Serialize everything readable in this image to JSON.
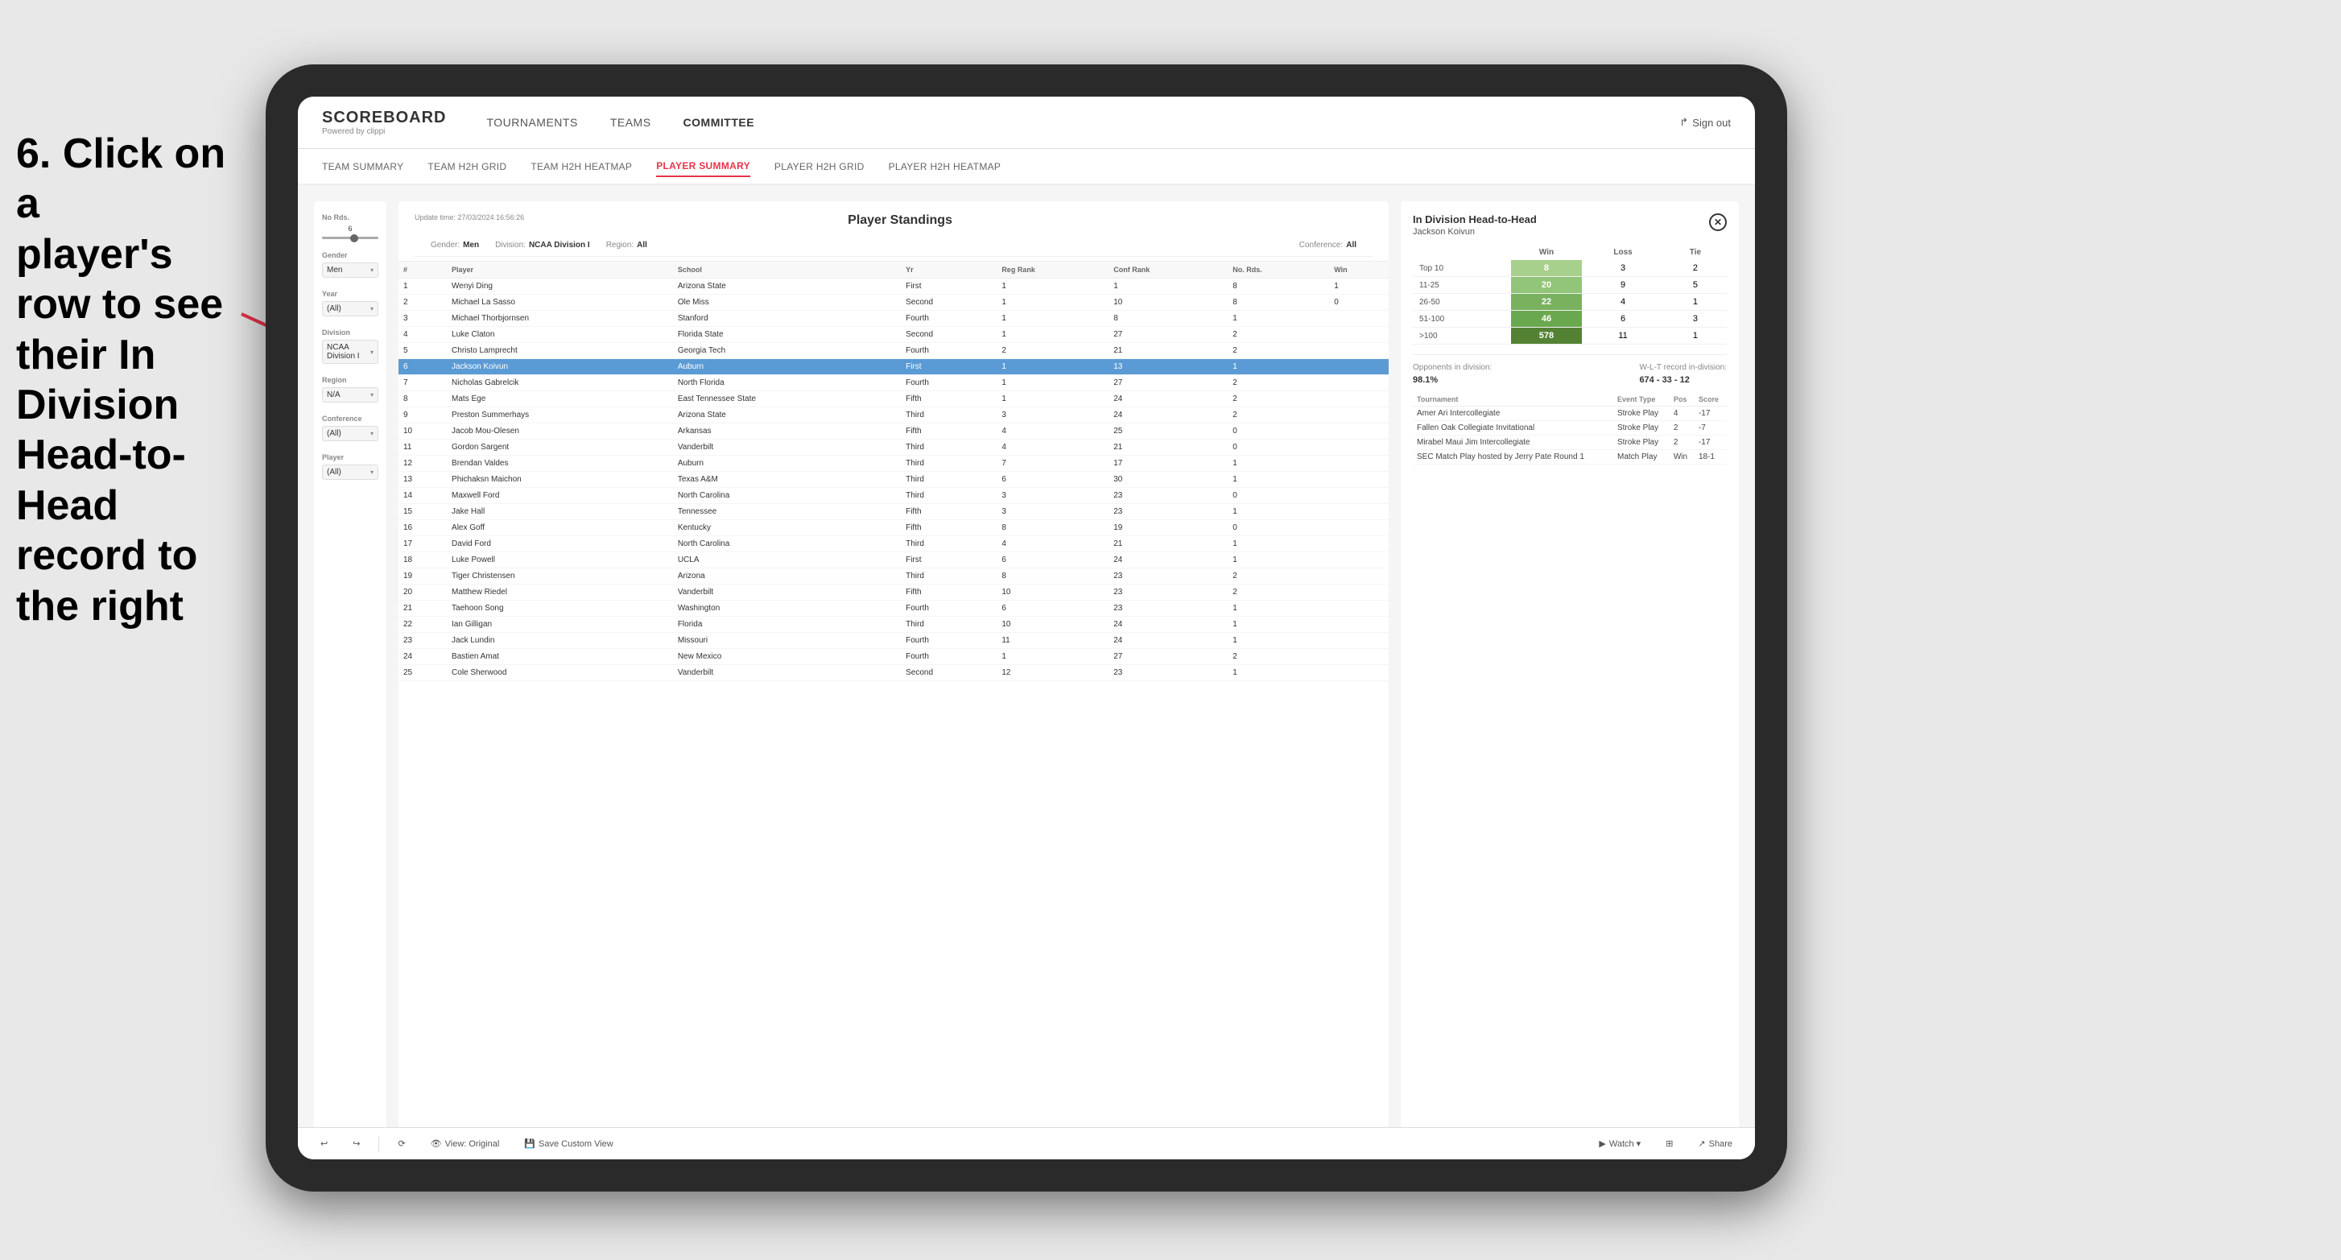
{
  "instruction": {
    "line1": "6. Click on a",
    "line2": "player's row to see",
    "line3": "their In Division",
    "line4": "Head-to-Head",
    "line5": "record to the right"
  },
  "app": {
    "logo": "SCOREBOARD",
    "logo_sub": "Powered by clippi",
    "sign_out": "Sign out"
  },
  "nav": {
    "items": [
      {
        "label": "TOURNAMENTS",
        "active": false
      },
      {
        "label": "TEAMS",
        "active": false
      },
      {
        "label": "COMMITTEE",
        "active": true
      }
    ]
  },
  "sub_nav": {
    "items": [
      {
        "label": "TEAM SUMMARY",
        "active": false
      },
      {
        "label": "TEAM H2H GRID",
        "active": false
      },
      {
        "label": "TEAM H2H HEATMAP",
        "active": false
      },
      {
        "label": "PLAYER SUMMARY",
        "active": true
      },
      {
        "label": "PLAYER H2H GRID",
        "active": false
      },
      {
        "label": "PLAYER H2H HEATMAP",
        "active": false
      }
    ]
  },
  "sidebar": {
    "no_rds_label": "No Rds.",
    "no_rds_value": "6",
    "gender_label": "Gender",
    "gender_value": "Men",
    "year_label": "Year",
    "year_value": "(All)",
    "division_label": "Division",
    "division_value": "NCAA Division I",
    "region_label": "Region",
    "region_value": "N/A",
    "conference_label": "Conference",
    "conference_value": "(All)",
    "player_label": "Player",
    "player_value": "(All)"
  },
  "panel": {
    "title": "Player Standings",
    "update_time": "Update time:",
    "update_date": "27/03/2024 16:56:26",
    "gender_label": "Gender:",
    "gender_value": "Men",
    "division_label": "Division:",
    "division_value": "NCAA Division I",
    "region_label": "Region:",
    "region_value": "All",
    "conference_label": "Conference:",
    "conference_value": "All",
    "columns": [
      "#",
      "Player",
      "School",
      "Yr",
      "Reg Rank",
      "Conf Rank",
      "No. Rds.",
      "Win"
    ],
    "rows": [
      {
        "num": "1",
        "player": "Wenyi Ding",
        "school": "Arizona State",
        "yr": "First",
        "reg": "1",
        "conf": "1",
        "rds": "8",
        "win": "1"
      },
      {
        "num": "2",
        "player": "Michael La Sasso",
        "school": "Ole Miss",
        "yr": "Second",
        "reg": "1",
        "conf": "10",
        "rds": "8",
        "win": "0"
      },
      {
        "num": "3",
        "player": "Michael Thorbjornsen",
        "school": "Stanford",
        "yr": "Fourth",
        "reg": "1",
        "conf": "8",
        "rds": "1"
      },
      {
        "num": "4",
        "player": "Luke Claton",
        "school": "Florida State",
        "yr": "Second",
        "reg": "1",
        "conf": "27",
        "rds": "2"
      },
      {
        "num": "5",
        "player": "Christo Lamprecht",
        "school": "Georgia Tech",
        "yr": "Fourth",
        "reg": "2",
        "conf": "21",
        "rds": "2"
      },
      {
        "num": "6",
        "player": "Jackson Koivun",
        "school": "Auburn",
        "yr": "First",
        "reg": "1",
        "conf": "13",
        "rds": "1",
        "highlighted": true
      },
      {
        "num": "7",
        "player": "Nicholas Gabrelcik",
        "school": "North Florida",
        "yr": "Fourth",
        "reg": "1",
        "conf": "27",
        "rds": "2"
      },
      {
        "num": "8",
        "player": "Mats Ege",
        "school": "East Tennessee State",
        "yr": "Fifth",
        "reg": "1",
        "conf": "24",
        "rds": "2"
      },
      {
        "num": "9",
        "player": "Preston Summerhays",
        "school": "Arizona State",
        "yr": "Third",
        "reg": "3",
        "conf": "24",
        "rds": "2"
      },
      {
        "num": "10",
        "player": "Jacob Mou-Olesen",
        "school": "Arkansas",
        "yr": "Fifth",
        "reg": "4",
        "conf": "25",
        "rds": "0"
      },
      {
        "num": "11",
        "player": "Gordon Sargent",
        "school": "Vanderbilt",
        "yr": "Third",
        "reg": "4",
        "conf": "21",
        "rds": "0"
      },
      {
        "num": "12",
        "player": "Brendan Valdes",
        "school": "Auburn",
        "yr": "Third",
        "reg": "7",
        "conf": "17",
        "rds": "1"
      },
      {
        "num": "13",
        "player": "Phichaksn Maichon",
        "school": "Texas A&M",
        "yr": "Third",
        "reg": "6",
        "conf": "30",
        "rds": "1"
      },
      {
        "num": "14",
        "player": "Maxwell Ford",
        "school": "North Carolina",
        "yr": "Third",
        "reg": "3",
        "conf": "23",
        "rds": "0"
      },
      {
        "num": "15",
        "player": "Jake Hall",
        "school": "Tennessee",
        "yr": "Fifth",
        "reg": "3",
        "conf": "23",
        "rds": "1"
      },
      {
        "num": "16",
        "player": "Alex Goff",
        "school": "Kentucky",
        "yr": "Fifth",
        "reg": "8",
        "conf": "19",
        "rds": "0"
      },
      {
        "num": "17",
        "player": "David Ford",
        "school": "North Carolina",
        "yr": "Third",
        "reg": "4",
        "conf": "21",
        "rds": "1"
      },
      {
        "num": "18",
        "player": "Luke Powell",
        "school": "UCLA",
        "yr": "First",
        "reg": "6",
        "conf": "24",
        "rds": "1"
      },
      {
        "num": "19",
        "player": "Tiger Christensen",
        "school": "Arizona",
        "yr": "Third",
        "reg": "8",
        "conf": "23",
        "rds": "2"
      },
      {
        "num": "20",
        "player": "Matthew Riedel",
        "school": "Vanderbilt",
        "yr": "Fifth",
        "reg": "10",
        "conf": "23",
        "rds": "2"
      },
      {
        "num": "21",
        "player": "Taehoon Song",
        "school": "Washington",
        "yr": "Fourth",
        "reg": "6",
        "conf": "23",
        "rds": "1"
      },
      {
        "num": "22",
        "player": "Ian Gilligan",
        "school": "Florida",
        "yr": "Third",
        "reg": "10",
        "conf": "24",
        "rds": "1"
      },
      {
        "num": "23",
        "player": "Jack Lundin",
        "school": "Missouri",
        "yr": "Fourth",
        "reg": "11",
        "conf": "24",
        "rds": "1"
      },
      {
        "num": "24",
        "player": "Bastien Amat",
        "school": "New Mexico",
        "yr": "Fourth",
        "reg": "1",
        "conf": "27",
        "rds": "2"
      },
      {
        "num": "25",
        "player": "Cole Sherwood",
        "school": "Vanderbilt",
        "yr": "Second",
        "reg": "12",
        "conf": "23",
        "rds": "1"
      }
    ]
  },
  "h2h": {
    "title": "In Division Head-to-Head",
    "player": "Jackson Koivun",
    "columns": [
      "Win",
      "Loss",
      "Tie"
    ],
    "rows": [
      {
        "range": "Top 10",
        "win": "8",
        "loss": "3",
        "tie": "2"
      },
      {
        "range": "11-25",
        "win": "20",
        "loss": "9",
        "tie": "5"
      },
      {
        "range": "26-50",
        "win": "22",
        "loss": "4",
        "tie": "1"
      },
      {
        "range": "51-100",
        "win": "46",
        "loss": "6",
        "tie": "3"
      },
      {
        "range": ">100",
        "win": "578",
        "loss": "11",
        "tie": "1"
      }
    ],
    "opponents_label": "Opponents in division:",
    "opponents_value": "98.1%",
    "record_label": "W-L-T record in-division:",
    "record_value": "674 - 33 - 12",
    "tournament_columns": [
      "Tournament",
      "Event Type",
      "Pos",
      "Score"
    ],
    "tournaments": [
      {
        "name": "Amer Ari Intercollegiate",
        "type": "Stroke Play",
        "pos": "4",
        "score": "-17"
      },
      {
        "name": "Fallen Oak Collegiate Invitational",
        "type": "Stroke Play",
        "pos": "2",
        "score": "-7"
      },
      {
        "name": "Mirabel Maui Jim Intercollegiate",
        "type": "Stroke Play",
        "pos": "2",
        "score": "-17"
      },
      {
        "name": "SEC Match Play hosted by Jerry Pate Round 1",
        "type": "Match Play",
        "pos": "Win",
        "score": "18-1"
      }
    ]
  },
  "toolbar": {
    "view_original": "View: Original",
    "save_custom_view": "Save Custom View",
    "watch": "Watch ▾",
    "share": "Share"
  }
}
